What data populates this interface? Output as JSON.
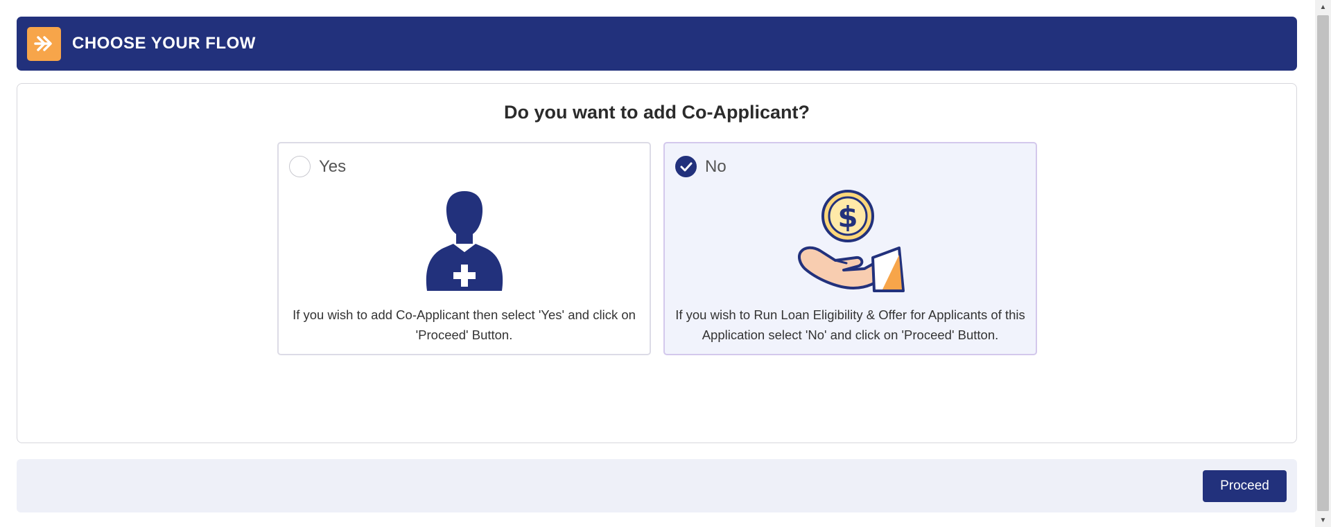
{
  "header": {
    "title": "CHOOSE YOUR FLOW",
    "icon": "double-chevron-right-icon"
  },
  "question": "Do you want to add Co-Applicant?",
  "options": [
    {
      "label": "Yes",
      "selected": false,
      "icon": "add-user-icon",
      "description": "If you wish to add Co-Applicant then select 'Yes' and click on 'Proceed' Button."
    },
    {
      "label": "No",
      "selected": true,
      "icon": "hand-coin-icon",
      "description": "If you wish to Run Loan Eligibility & Offer for Applicants of this Application select 'No' and click on 'Proceed' Button."
    }
  ],
  "footer": {
    "proceed_label": "Proceed"
  },
  "colors": {
    "primary": "#22317c",
    "accent": "#f7a54a",
    "selected_bg": "#f1f3fc",
    "footer_bg": "#eef0f8"
  }
}
